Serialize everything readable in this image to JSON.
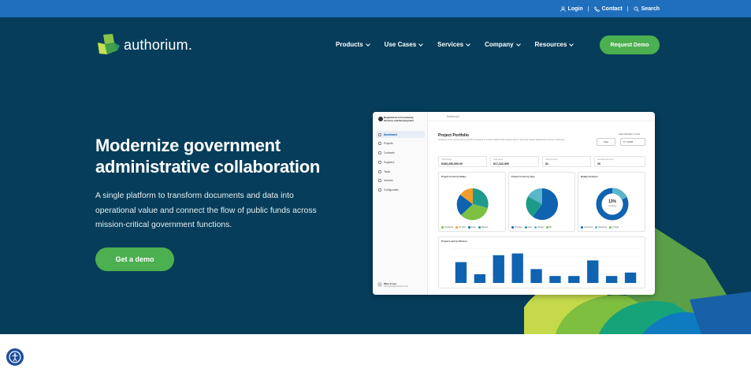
{
  "topbar": {
    "login": "Login",
    "contact": "Contact",
    "search": "Search",
    "separator": "|"
  },
  "logo": {
    "text": "authorium."
  },
  "nav": {
    "items": [
      "Products",
      "Use Cases",
      "Services",
      "Company",
      "Resources"
    ],
    "cta": "Request Demo"
  },
  "hero": {
    "title": "Modernize government administrative collaboration",
    "description": "A single platform to transform documents and data into operational value and connect the flow of public funds across mission-critical government functions.",
    "cta": "Get a demo"
  },
  "screenshot": {
    "org": "Department of Community Services and Development",
    "menu": [
      "Dashboard",
      "Projects",
      "Contracts",
      "Suppliers",
      "Tasks",
      "Invoices",
      "Configuration"
    ],
    "breadcrumb": "Dashboard",
    "page_title": "Project Portfolio",
    "page_subtitle": "Snapshot of the current active portfolio of projects to include budgets that projects spend, upcoming budget adjustments and key milestones.",
    "budget_label": "Select Budget to View",
    "budget_value": "FY 24/25",
    "view_button": "View",
    "kpis": [
      {
        "label": "Total Budget",
        "value": "$183,250,000.00"
      },
      {
        "label": "Total Spent",
        "value": "$17,222,500"
      },
      {
        "label": "Active Projects",
        "value": "81"
      },
      {
        "label": "Remaining Projects",
        "value": "26"
      }
    ],
    "cards": {
      "status": "Project Count by Status",
      "type": "Project Count by Type",
      "budget": "Budget Analysis",
      "line": "Project Load by Division"
    },
    "donut_center": "13%",
    "donut_sub": "remaining",
    "status_legend": [
      "Completed",
      "On Hold",
      "Active",
      "Planned"
    ],
    "type_legend": [
      "Purchase",
      "Grant",
      "Budget",
      "Bill"
    ],
    "budget_legend": [
      "Committed",
      "Remaining",
      "In Flight"
    ],
    "user_name": "Mike Jones",
    "user_email": "mike.jones@authorium.com"
  },
  "colors": {
    "hero_bg": "#063d5a",
    "topbar": "#1f6fbd",
    "accent_green": "#4caf50"
  },
  "icons": [
    "user-icon",
    "phone-icon",
    "search-icon",
    "chevron-down-icon",
    "accessibility-icon"
  ],
  "chart_data": {
    "type": "bar",
    "title": "Project Load by Division",
    "values": [
      12,
      5,
      16,
      17,
      8,
      4,
      4,
      13,
      4,
      6
    ],
    "ylim": [
      0,
      20
    ]
  }
}
